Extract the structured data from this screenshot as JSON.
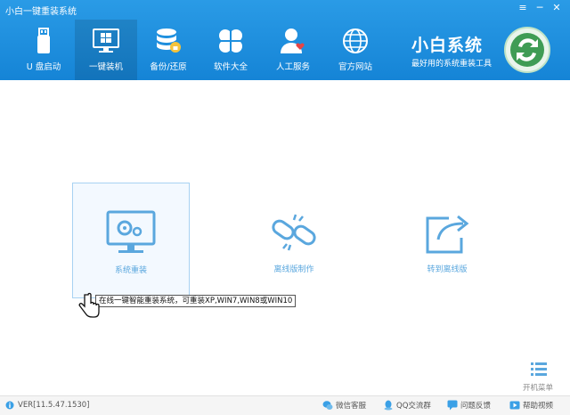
{
  "window": {
    "title": "小白一键重装系统",
    "menu_glyph": "≡",
    "minimize_glyph": "─",
    "close_glyph": "✕"
  },
  "nav": {
    "items": [
      {
        "label": "U 盘启动",
        "icon": "usb-drive-icon"
      },
      {
        "label": "一键装机",
        "icon": "windows-monitor-icon",
        "active": true
      },
      {
        "label": "备份/还原",
        "icon": "database-lock-icon"
      },
      {
        "label": "软件大全",
        "icon": "clover-apps-icon"
      },
      {
        "label": "人工服务",
        "icon": "user-heart-icon"
      },
      {
        "label": "官方网站",
        "icon": "globe-icon"
      }
    ]
  },
  "brand": {
    "name": "小白系统",
    "slogan": "最好用的系统重装工具"
  },
  "cards": [
    {
      "label": "系统重装",
      "icon": "monitor-gears-icon",
      "selected": true
    },
    {
      "label": "离线版制作",
      "icon": "broken-link-icon"
    },
    {
      "label": "转到离线版",
      "icon": "share-arrow-icon"
    }
  ],
  "tooltip": {
    "text": "在线一键智能重装系统，可重装XP,WIN7,WIN8或WIN10"
  },
  "boot_menu": {
    "label": "开机菜单"
  },
  "footer": {
    "version": "VER[11.5.47.1530]",
    "links": [
      {
        "label": "微信客服",
        "icon": "wechat-icon"
      },
      {
        "label": "QQ交流群",
        "icon": "qq-icon"
      },
      {
        "label": "问题反馈",
        "icon": "feedback-icon"
      },
      {
        "label": "帮助视频",
        "icon": "video-icon"
      }
    ]
  },
  "colors": {
    "header_blue": "#1e8fde",
    "accent_blue": "#5aa7de",
    "selected_bg": "#f3f9ff"
  }
}
